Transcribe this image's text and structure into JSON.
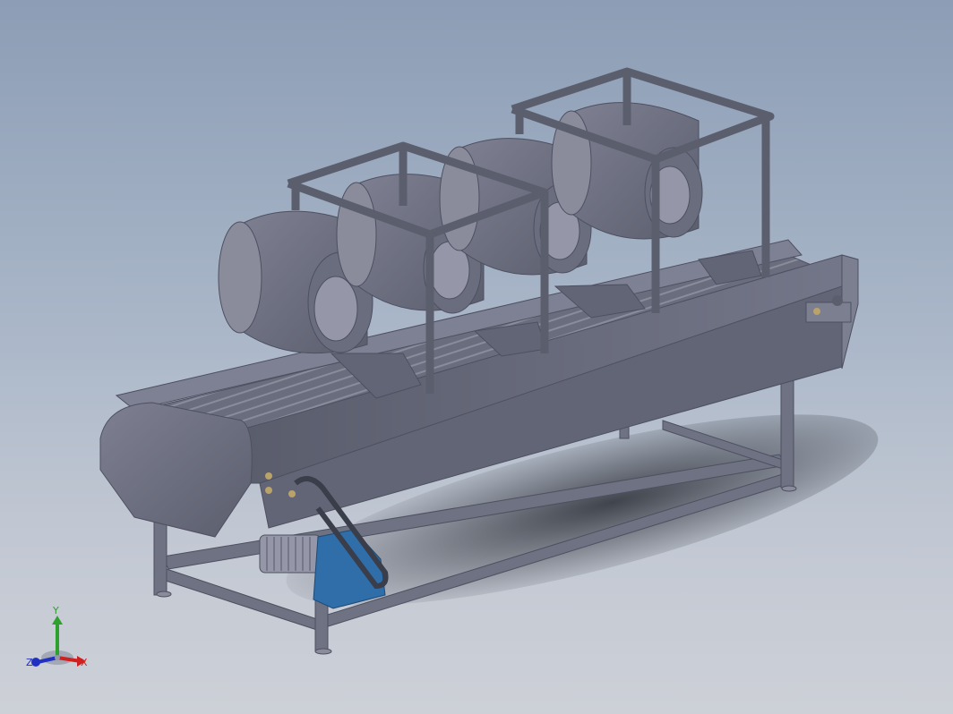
{
  "viewport": {
    "model": "conveyor-air-dryer-assembly",
    "background_top": "#8c9db5",
    "background_bottom": "#cdd0d7"
  },
  "colors": {
    "metal": "#6f7283",
    "metal_dark": "#4d5060",
    "metal_light": "#9597a8",
    "motor_blue": "#2f6ea8"
  },
  "orientation_triad": {
    "y_label": "Y",
    "x_label": "X",
    "z_label": "Z",
    "y_color": "#2ea02e",
    "x_color": "#d02020",
    "z_color": "#2030c0"
  }
}
